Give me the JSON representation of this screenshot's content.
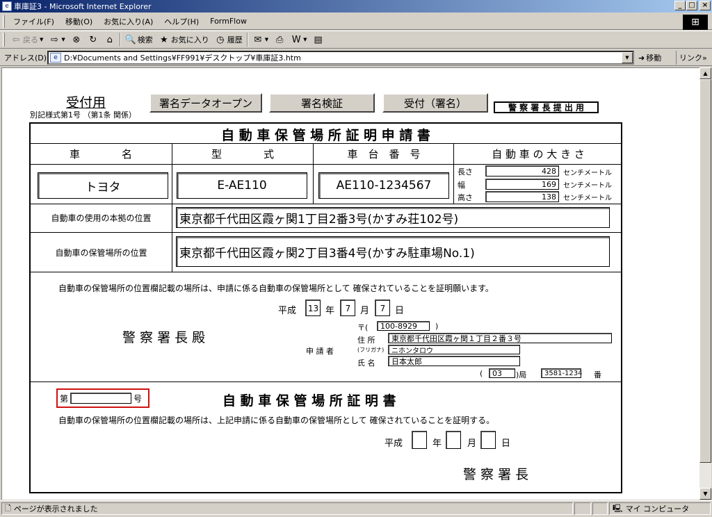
{
  "window": {
    "title": "車庫証3 - Microsoft Internet Explorer",
    "buttons": {
      "minimize": "_",
      "maximize": "□",
      "close": "×"
    }
  },
  "menubar": {
    "items": [
      "ファイル(F)",
      "移動(O)",
      "お気に入り(A)",
      "ヘルプ(H)",
      "FormFlow"
    ]
  },
  "toolbar": {
    "back": "戻る",
    "search": "検索",
    "favorites": "お気に入り",
    "history": "履歴"
  },
  "addressbar": {
    "label": "アドレス(D)",
    "url": "D:¥Documents and Settings¥FF991¥デスクトップ¥車庫証3.htm",
    "go": "移動",
    "links": "リンク"
  },
  "statusbar": {
    "text": "ページが表示されました",
    "zone": "マイ コンピュータ"
  },
  "form": {
    "receipt_title": "受付用",
    "form_ref": "別記様式第1号 （第1条 関係）",
    "buttons": {
      "open_signature": "署名データオープン",
      "verify_signature": "署名検証",
      "accept_signature": "受付（署名）"
    },
    "submit_label": "警 察 署 長 提 出 用",
    "title": "自 動 車 保 管 場 所 証 明 申 請 書",
    "headers": {
      "car_name": "車　　　　名",
      "model": "型　　　　式",
      "chassis": "車　台　番　号",
      "size": "自 動 車 の 大 き さ"
    },
    "car_name": "トヨタ",
    "model": "E-AE110",
    "chassis": "AE110-1234567",
    "size": {
      "length_label": "長さ",
      "length": "428",
      "width_label": "幅",
      "width": "169",
      "height_label": "高さ",
      "height": "138",
      "unit": "センチメートル"
    },
    "base_location_label": "自動車の使用の本拠の位置",
    "base_location": "東京都千代田区霞ヶ関1丁目2番3号(かすみ荘102号)",
    "storage_location_label": "自動車の保管場所の位置",
    "storage_location": "東京都千代田区霞ヶ関2丁目3番4号(かすみ駐車場No.1)",
    "request_text": "自動車の保管場所の位置欄記載の場所は、申請に係る自動車の保管場所として 確保されていることを証明願います。",
    "date": {
      "era": "平成",
      "year": "13",
      "year_label": "年",
      "month": "7",
      "month_label": "月",
      "day": "7",
      "day_label": "日"
    },
    "addressee": "警 察 署 長 殿",
    "applicant_label": "申 請 者",
    "postal_label": "〒(",
    "postal_close": ")",
    "postal": "100-8929",
    "address_label": "住 所",
    "address": "東京都千代田区霞ヶ関１丁目２番３号",
    "furigana_label": "(フリガナ)",
    "furigana": "ニホンタロウ",
    "name_label": "氏 名",
    "name": "日本太郎",
    "phone_open": "(",
    "phone_area": "03",
    "phone_bureau_label": ")局",
    "phone_number": "3581-1234",
    "phone_suffix": "番",
    "cert_no_prefix": "第",
    "cert_no_value": "",
    "cert_no_suffix": "号",
    "cert_title": "自 動 車 保 管 場 所 証 明 書",
    "cert_text": "自動車の保管場所の位置欄記載の場所は、上記申請に係る自動車の保管場所として 確保されていることを証明する。",
    "cert_date": {
      "era": "平成",
      "year": "",
      "year_label": "年",
      "month": "",
      "month_label": "月",
      "day": "",
      "day_label": "日"
    },
    "cert_signer": "警 察 署 長"
  }
}
